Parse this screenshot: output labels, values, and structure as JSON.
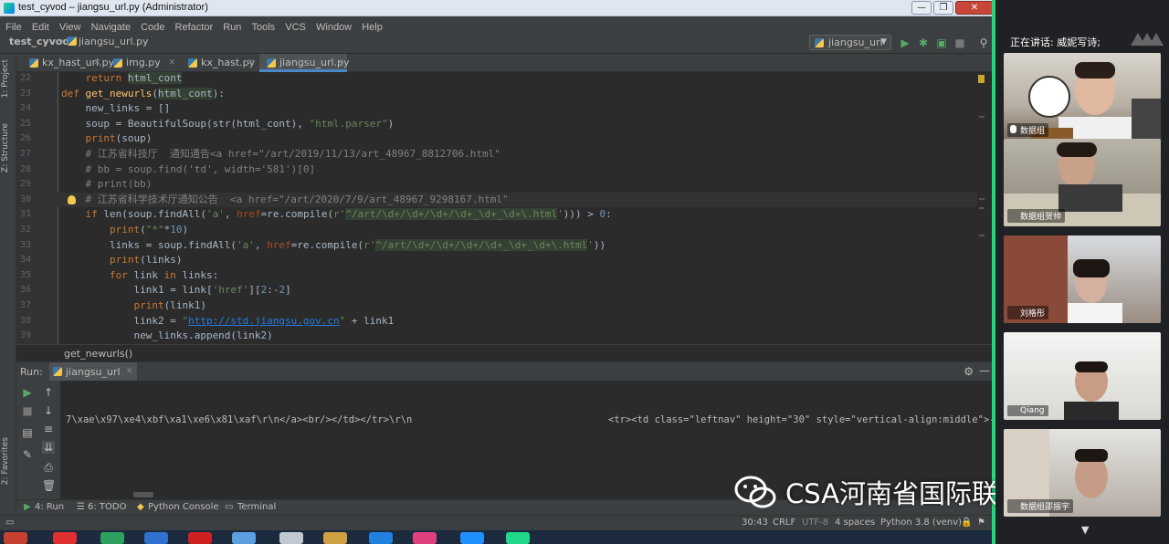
{
  "window": {
    "title": "test_cyvod – jiangsu_url.py (Administrator)",
    "buttons": [
      "—",
      "❐",
      "✕"
    ]
  },
  "menu": [
    "File",
    "Edit",
    "View",
    "Navigate",
    "Code",
    "Refactor",
    "Run",
    "Tools",
    "VCS",
    "Window",
    "Help"
  ],
  "nav": {
    "project": "test_cyvod",
    "file": "jiangsu_url.py",
    "run_config": "jiangsu_url"
  },
  "side_stripe": {
    "project": "1: Project",
    "structure": "Z: Structure",
    "favorites": "2: Favorites"
  },
  "tabs": [
    {
      "label": "kx_hast_url.py",
      "active": false
    },
    {
      "label": "img.py",
      "active": false
    },
    {
      "label": "kx_hast.py",
      "active": false
    },
    {
      "label": "jiangsu_url.py",
      "active": true
    }
  ],
  "code_lines": [
    {
      "num": "22",
      "html": "    <span class=\"kw\">return</span> <span class=\"hl\">html_cont</span>"
    },
    {
      "num": "23",
      "html": "<span class=\"kw\">def</span> <span class=\"fn\">get_newurls</span>(<span class=\"hl\">html_cont</span>):"
    },
    {
      "num": "24",
      "html": "    new_links = []"
    },
    {
      "num": "25",
      "html": "    soup = BeautifulSoup(str(html_cont), <span class=\"str\">\"html.parser\"</span>)"
    },
    {
      "num": "26",
      "html": "    <span class=\"kw\">print</span>(soup)"
    },
    {
      "num": "27",
      "html": "    <span class=\"cm\"># 江苏省科技厅  通知通告&lt;a href=\"/art/2019/11/13/art_48967_8812706.html\"</span>"
    },
    {
      "num": "28",
      "html": "    <span class=\"cm\"># bb = soup.find('td', width='581')[0]</span>"
    },
    {
      "num": "29",
      "html": "    <span class=\"cm\"># print(bb)</span>"
    },
    {
      "num": "30",
      "html": "    <span class=\"cm\"># 江苏省科学技术厅通知公告  &lt;a href=\"/art/2020/7/9/art_48967_9298167.html\"</span>",
      "current": true
    },
    {
      "num": "31",
      "html": "    <span class=\"kw\">if</span> len(soup.findAll(<span class=\"str\">'a'</span>, <span class=\"kwarg\">href</span>=re.compile(<span class=\"str\">r'<span class=\"hl\">^/art/\\d+/\\d+/\\d+/\\d+_\\d+_\\d+\\.html</span>'</span>))) &gt; <span class=\"num2\">0</span>:"
    },
    {
      "num": "32",
      "html": "        <span class=\"kw\">print</span>(<span class=\"str\">\"*\"</span>*<span class=\"num2\">10</span>)"
    },
    {
      "num": "33",
      "html": "        links = soup.findAll(<span class=\"str\">'a'</span>, <span class=\"kwarg\">href</span>=re.compile(<span class=\"str\">r'<span class=\"hl\">^/art/\\d+/\\d+/\\d+/\\d+_\\d+_\\d+\\.html</span>'</span>))"
    },
    {
      "num": "34",
      "html": "        <span class=\"kw\">print</span>(links)"
    },
    {
      "num": "35",
      "html": "        <span class=\"kw\">for</span> link <span class=\"kw\">in</span> links:"
    },
    {
      "num": "36",
      "html": "            link1 = link[<span class=\"str\">'href'</span>][<span class=\"num2\">2</span>:-<span class=\"num2\">2</span>]"
    },
    {
      "num": "37",
      "html": "            <span class=\"kw\">print</span>(link1)"
    },
    {
      "num": "38",
      "html": "            link2 = <span class=\"str\">\"<span class=\"url\">http://std.jiangsu.gov.cn</span>\"</span> + link1"
    },
    {
      "num": "39",
      "html": "            new_links.append(link2)"
    }
  ],
  "editor_breadcrumb": "get_newurls()",
  "run": {
    "label": "Run:",
    "tab": "jiangsu_url",
    "output_left": "7\\xae\\x97\\xe4\\xbf\\xa1\\xe6\\x81\\xaf\\r\\n</a><br/></td></tr>\\r\\n",
    "output_right": "<tr><td class=\"leftnav\" height=\"30\" style=\"vertical-align:middle\">-"
  },
  "bottom_tabs": [
    "4: Run",
    "6: TODO",
    "Python Console",
    "Terminal"
  ],
  "status": {
    "position": "30:43",
    "line_sep": "CRLF",
    "encoding": "UTF-8",
    "indent": "4 spaces",
    "interpreter": "Python 3.8 (venv)"
  },
  "meeting": {
    "speaking": "正在讲话: 威妮写诗;",
    "participants": [
      {
        "name": "数据组"
      },
      {
        "name": "数据组贺帅"
      },
      {
        "name": "刘格彤"
      },
      {
        "name": "Qiang"
      },
      {
        "name": "数据组邵振宇"
      }
    ]
  },
  "watermark": "CSA河南省国际联合实验室",
  "colors": {
    "accent_green": "#1fd97a",
    "editor_bg": "#2b2b2b",
    "keyword": "#cc7832"
  }
}
